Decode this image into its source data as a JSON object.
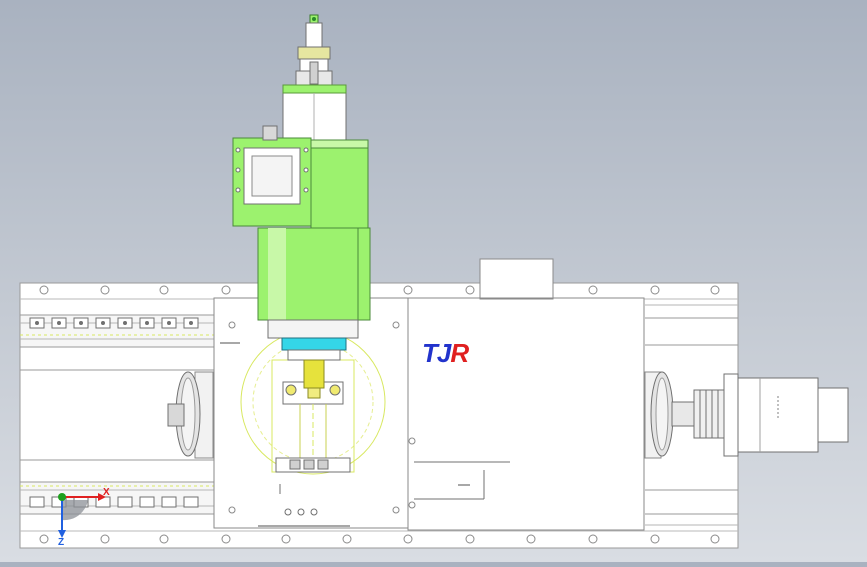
{
  "logo": {
    "part1": "TJ",
    "part2": "R"
  },
  "triad": {
    "x_label": "X",
    "z_label": "Z"
  },
  "colors": {
    "background_top": "#a9b2c0",
    "spindle_green": "#9cf26e",
    "collet_cyan": "#34d6e8",
    "tool_yellow": "#e6e23c",
    "logo_blue": "#2233cc",
    "logo_red": "#e02020",
    "axis_x": "#e02020",
    "axis_y": "#1ea01e",
    "axis_z": "#2060e0"
  },
  "icons": [
    "coordinate-triad-icon",
    "view-pivot-icon"
  ]
}
